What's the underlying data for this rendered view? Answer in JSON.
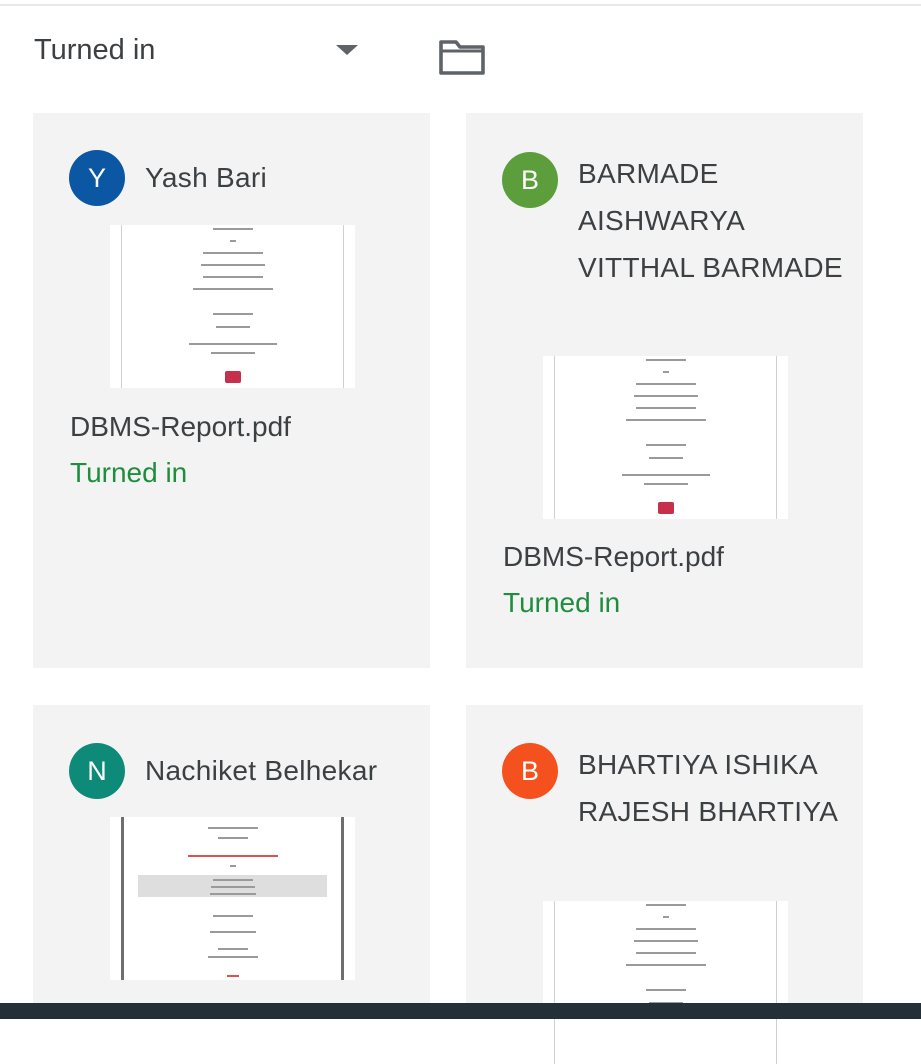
{
  "filter": {
    "label": "Turned in",
    "options_icon": "chevron-down-icon",
    "folder_icon": "folder-icon"
  },
  "colors": {
    "card_bg": "#f3f3f4",
    "status_green": "#1e8e3e",
    "bottom_bar": "#243038"
  },
  "submissions": [
    {
      "initial": "Y",
      "avatar_color": "#0b57a3",
      "name": "Yash Bari",
      "file": "DBMS-Report.pdf",
      "status": "Turned in"
    },
    {
      "initial": "B",
      "avatar_color": "#5c9e3c",
      "name": "BARMADE AISHWARYA VITTHAL BARMADE",
      "file": "DBMS-Report.pdf",
      "status": "Turned in"
    },
    {
      "initial": "N",
      "avatar_color": "#0e8a78",
      "name": "Nachiket Belhekar",
      "file": "",
      "status": ""
    },
    {
      "initial": "B",
      "avatar_color": "#f4511e",
      "name": "BHARTIYA ISHIKA RAJESH BHARTIYA",
      "file": "",
      "status": ""
    }
  ]
}
